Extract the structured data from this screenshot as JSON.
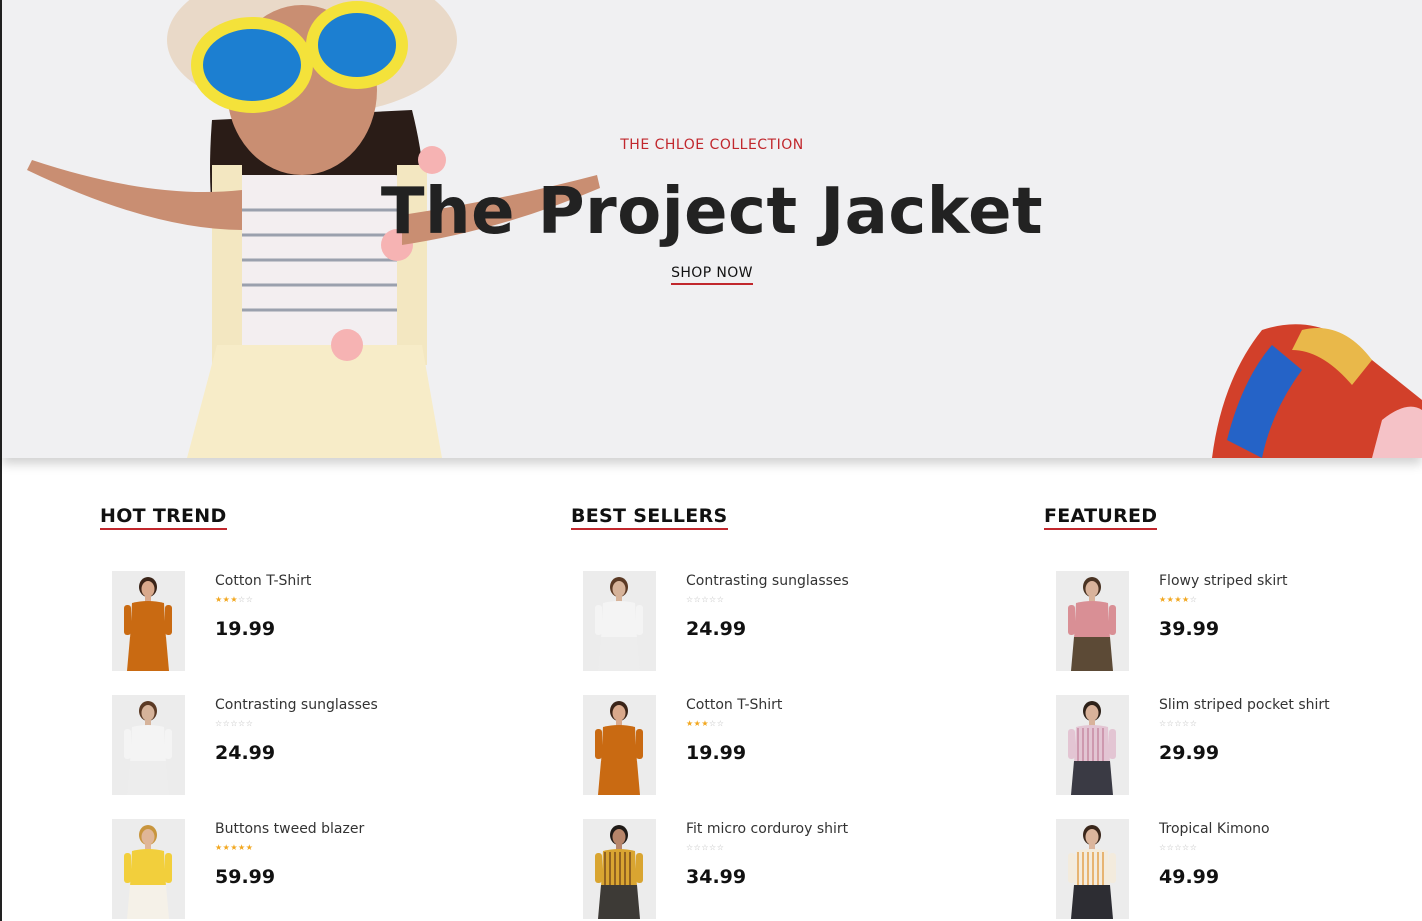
{
  "hero": {
    "eyebrow": "THE CHLOE COLLECTION",
    "title": "The Project Jacket",
    "cta_label": "SHOP NOW",
    "accent_color": "#c1272d"
  },
  "sections": [
    {
      "heading": "HOT TREND",
      "products": [
        {
          "name": "Cotton T-Shirt",
          "rating": 3,
          "price": "19.99",
          "image": "orange-dress"
        },
        {
          "name": "Contrasting sunglasses",
          "rating": 0,
          "price": "24.99",
          "image": "white-dress"
        },
        {
          "name": "Buttons tweed blazer",
          "rating": 5,
          "price": "59.99",
          "image": "yellow-blazer"
        }
      ]
    },
    {
      "heading": "BEST SELLERS",
      "products": [
        {
          "name": "Contrasting sunglasses",
          "rating": 0,
          "price": "24.99",
          "image": "white-dress"
        },
        {
          "name": "Cotton T-Shirt",
          "rating": 3,
          "price": "19.99",
          "image": "orange-dress"
        },
        {
          "name": "Fit micro corduroy shirt",
          "rating": 0,
          "price": "34.99",
          "image": "striped-shirt-yellow"
        }
      ]
    },
    {
      "heading": "FEATURED",
      "products": [
        {
          "name": "Flowy striped skirt",
          "rating": 4,
          "price": "39.99",
          "image": "pink-jacket"
        },
        {
          "name": "Slim striped pocket shirt",
          "rating": 0,
          "price": "29.99",
          "image": "pink-shirt"
        },
        {
          "name": "Tropical Kimono",
          "rating": 0,
          "price": "49.99",
          "image": "floral-blouse"
        }
      ]
    }
  ]
}
